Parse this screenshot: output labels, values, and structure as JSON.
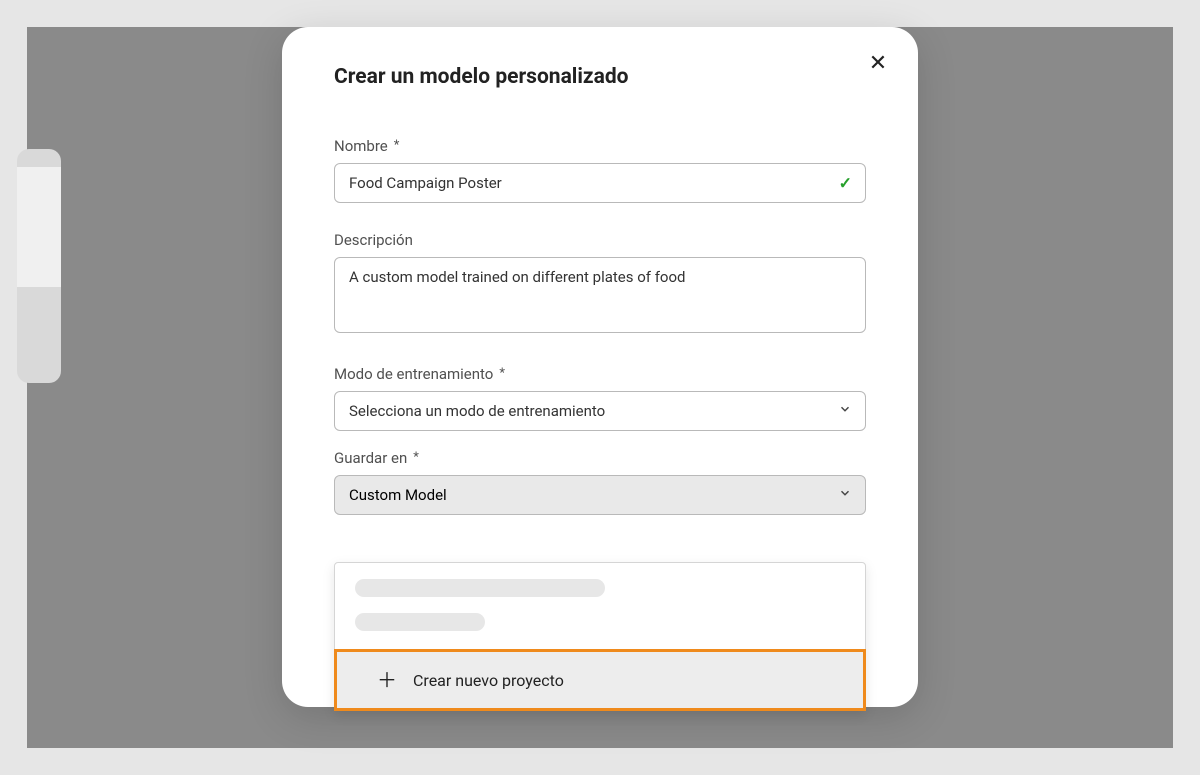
{
  "modal": {
    "title": "Crear un modelo personalizado",
    "fields": {
      "name": {
        "label": "Nombre",
        "value": "Food Campaign Poster"
      },
      "description": {
        "label": "Descripción",
        "value": "A custom model trained on different plates of food"
      },
      "trainingMode": {
        "label": "Modo de entrenamiento",
        "placeholder": "Selecciona un modo de entrenamiento"
      },
      "saveIn": {
        "label": "Guardar en",
        "value": "Custom Model"
      }
    },
    "dropdown": {
      "createOption": "Crear nuevo proyecto"
    }
  },
  "colors": {
    "accent_orange": "#ef8a1c",
    "valid_green": "#27a02c"
  }
}
